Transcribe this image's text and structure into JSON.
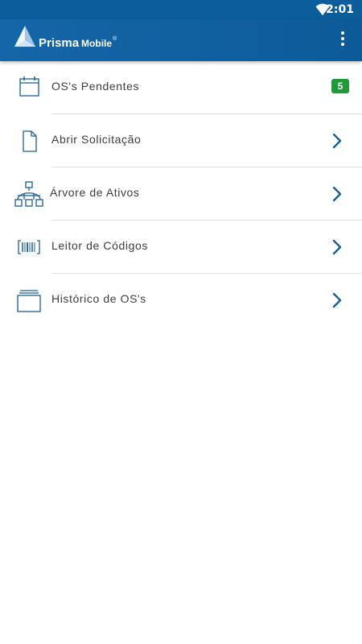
{
  "status_bar": {
    "time": "2:01",
    "wifi_icon": "wifi-icon"
  },
  "app_bar": {
    "brand_main": "Prisma",
    "brand_sub": "Mobile",
    "registered_mark": "®",
    "menu_icon": "more-vert-icon"
  },
  "colors": {
    "status_bar": "#0b5d9b",
    "app_bar": "#1566a8",
    "icon_blue": "#1b5e93",
    "badge_green": "#1e9a3b",
    "divider": "#dedede"
  },
  "menu": {
    "items": [
      {
        "label": "OS's Pendentes",
        "icon": "calendar-icon",
        "badge": "5"
      },
      {
        "label": "Abrir Solicitação",
        "icon": "document-icon",
        "trailing": "chevron-right-icon"
      },
      {
        "label": "Árvore de Ativos",
        "icon": "asset-tree-icon",
        "trailing": "chevron-right-icon"
      },
      {
        "label": "Leitor de Códigos",
        "icon": "barcode-scanner-icon",
        "trailing": "chevron-right-icon"
      },
      {
        "label": "Histórico de OS's",
        "icon": "history-folder-icon",
        "trailing": "chevron-right-icon"
      }
    ]
  }
}
